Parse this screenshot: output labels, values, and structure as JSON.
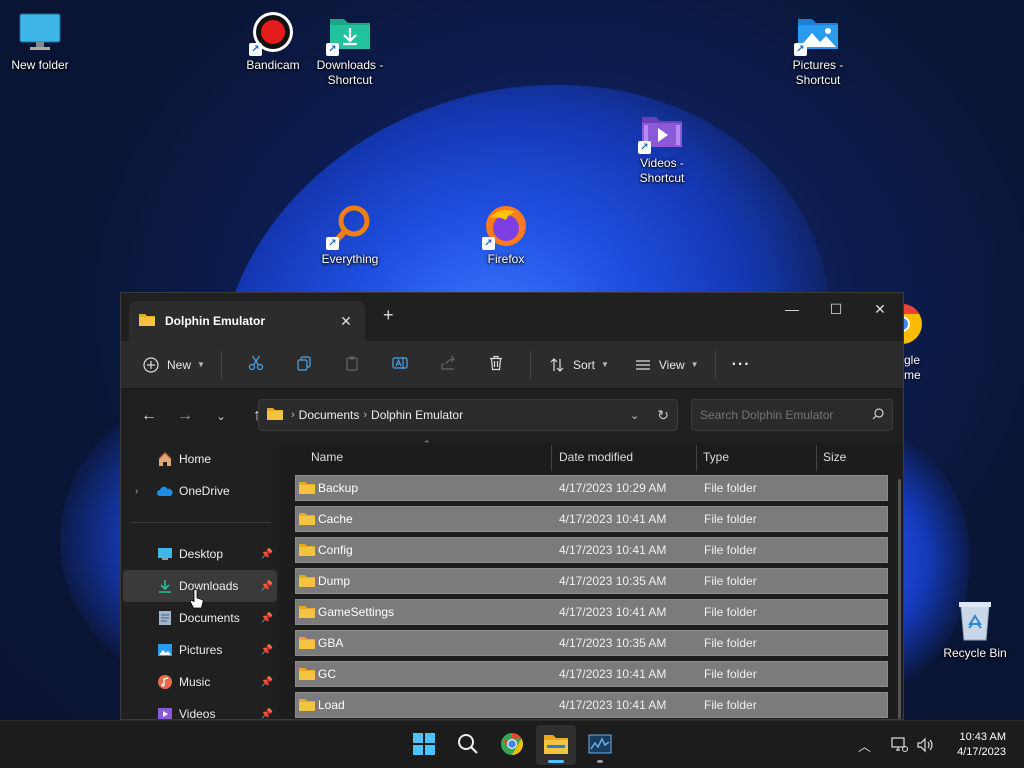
{
  "desktop": {
    "icons": [
      {
        "label": "New folder",
        "icon": "monitor-icon"
      },
      {
        "label": "Bandicam",
        "icon": "record-icon"
      },
      {
        "label": "Downloads - Shortcut",
        "icon": "downloads-folder-icon"
      },
      {
        "label": "Pictures - Shortcut",
        "icon": "pictures-folder-icon"
      },
      {
        "label": "Videos - Shortcut",
        "icon": "videos-folder-icon"
      },
      {
        "label": "Everything",
        "icon": "magnifier-icon"
      },
      {
        "label": "Firefox",
        "icon": "firefox-icon"
      },
      {
        "label": "gle",
        "icon": "chrome-icon"
      },
      {
        "label": "me",
        "icon": ""
      },
      {
        "label": "Recycle Bin",
        "icon": "recycle-bin-icon"
      }
    ]
  },
  "explorer": {
    "tab_title": "Dolphin Emulator",
    "toolbar": {
      "new_label": "New",
      "sort_label": "Sort",
      "view_label": "View",
      "more_label": "···"
    },
    "breadcrumb": [
      "Documents",
      "Dolphin Emulator"
    ],
    "search_placeholder": "Search Dolphin Emulator",
    "sidebar": [
      {
        "label": "Home",
        "icon": "home-icon",
        "pinned": false
      },
      {
        "label": "OneDrive",
        "icon": "cloud-icon",
        "pinned": false
      },
      {
        "label": "Desktop",
        "icon": "desktop-icon",
        "pinned": true
      },
      {
        "label": "Downloads",
        "icon": "download-icon",
        "pinned": true
      },
      {
        "label": "Documents",
        "icon": "document-icon",
        "pinned": true
      },
      {
        "label": "Pictures",
        "icon": "picture-icon",
        "pinned": true
      },
      {
        "label": "Music",
        "icon": "music-icon",
        "pinned": true
      },
      {
        "label": "Videos",
        "icon": "video-icon",
        "pinned": true
      }
    ],
    "columns": [
      "Name",
      "Date modified",
      "Type",
      "Size"
    ],
    "files": [
      {
        "name": "Backup",
        "date": "4/17/2023 10:29 AM",
        "type": "File folder"
      },
      {
        "name": "Cache",
        "date": "4/17/2023 10:41 AM",
        "type": "File folder"
      },
      {
        "name": "Config",
        "date": "4/17/2023 10:41 AM",
        "type": "File folder"
      },
      {
        "name": "Dump",
        "date": "4/17/2023 10:35 AM",
        "type": "File folder"
      },
      {
        "name": "GameSettings",
        "date": "4/17/2023 10:41 AM",
        "type": "File folder"
      },
      {
        "name": "GBA",
        "date": "4/17/2023 10:35 AM",
        "type": "File folder"
      },
      {
        "name": "GC",
        "date": "4/17/2023 10:41 AM",
        "type": "File folder"
      },
      {
        "name": "Load",
        "date": "4/17/2023 10:41 AM",
        "type": "File folder"
      }
    ]
  },
  "taskbar": {
    "apps": [
      "start-icon",
      "search-icon",
      "chrome-icon",
      "file-explorer-icon",
      "task-manager-icon"
    ],
    "time": "10:43 AM",
    "date": "4/17/2023"
  },
  "colors": {
    "accent": "#0078d4",
    "folder": "#f5c342",
    "window_bg": "#202020"
  }
}
